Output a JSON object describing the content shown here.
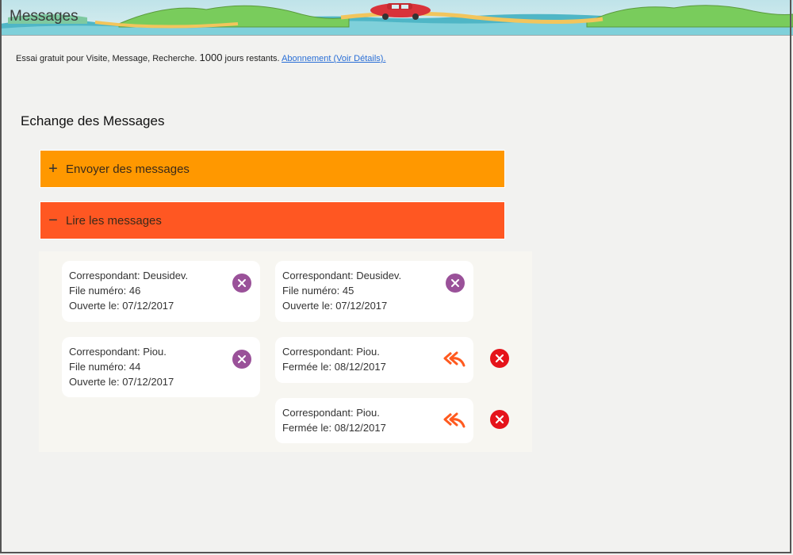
{
  "window": {
    "title": "Messages"
  },
  "trial": {
    "prefix": "Essai gratuit pour Visite, Message, Recherche.",
    "days": "1000",
    "suffix": "jours restants.",
    "link": "Abonnement (Voir Détails)."
  },
  "section": {
    "title": "Echange des Messages"
  },
  "accordion": {
    "send": {
      "sign": "+",
      "label": "Envoyer des messages",
      "color": "#ff9800"
    },
    "read": {
      "sign": "−",
      "label": "Lire les messages",
      "color": "#ff5722"
    }
  },
  "messages": [
    {
      "correspondent": "Correspondant: Deusidev.",
      "file": "File numéro: 46",
      "status": "Ouverte le: 07/12/2017",
      "action": "close-icon"
    },
    {
      "correspondent": "Correspondant: Deusidev.",
      "file": "File numéro: 45",
      "status": "Ouverte le: 07/12/2017",
      "action": "close-icon"
    },
    {
      "correspondent": "Correspondant: Piou.",
      "file": "File numéro: 44",
      "status": "Ouverte le: 07/12/2017",
      "action": "close-icon"
    },
    {
      "correspondent": "Correspondant: Piou.",
      "status": "Fermée le: 08/12/2017",
      "action": "reply-all-icon"
    },
    {
      "correspondent": "Correspondant: Piou.",
      "status": "Fermée le: 08/12/2017",
      "action": "reply-all-icon"
    }
  ],
  "colors": {
    "accent_orange": "#ff9800",
    "accent_red_orange": "#ff5722",
    "close_purple": "#9a5199",
    "delete_red": "#e5141b"
  }
}
